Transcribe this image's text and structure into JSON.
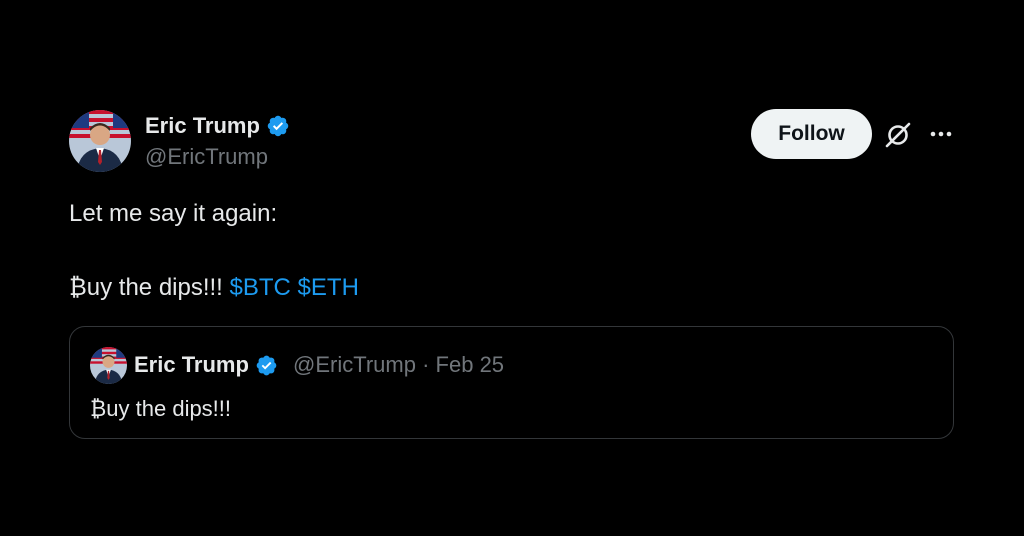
{
  "author": {
    "name": "Eric Trump",
    "handle": "@EricTrump"
  },
  "follow_label": "Follow",
  "tweet": {
    "line1": "Let me say it again:",
    "line2_text": "₿uy the dips!!!",
    "cashtags": [
      "$BTC",
      "$ETH"
    ]
  },
  "quote": {
    "name": "Eric Trump",
    "handle": "@EricTrump",
    "separator": "·",
    "date": "Feb 25",
    "text": "₿uy the dips!!!"
  },
  "icons": {
    "verified": "verified-badge-icon",
    "grok": "grok-icon",
    "more": "more-options-icon"
  },
  "colors": {
    "background": "#000000",
    "accent": "#1d9bf0",
    "text": "#e7e9ea",
    "muted": "#71767b"
  }
}
